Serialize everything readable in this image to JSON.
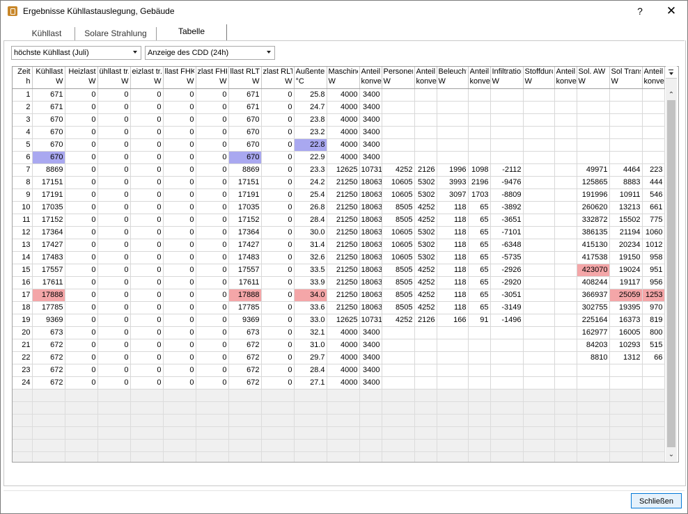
{
  "window": {
    "title": "Ergebnisse Kühllastauslegung, Gebäude",
    "help": "?",
    "close": "✕"
  },
  "tabs": [
    "Kühllast",
    "Solare Strahlung",
    "Tabelle"
  ],
  "active_tab": 2,
  "selects": {
    "month": "höchste Kühllast (Juli)",
    "view": "Anzeige des CDD (24h)"
  },
  "columns": [
    [
      "Zeit",
      "h"
    ],
    [
      "Kühllast",
      "W"
    ],
    [
      "Heizlast",
      "W"
    ],
    [
      "ühllast tr.",
      "W"
    ],
    [
      "eizlast tr.",
      "W"
    ],
    [
      "llast FHK",
      "W"
    ],
    [
      "zlast FHK",
      "W"
    ],
    [
      "llast RLT",
      "W"
    ],
    [
      "zlast RLT",
      "W"
    ],
    [
      "Außenten",
      "°C"
    ],
    [
      "Maschine",
      "W"
    ],
    [
      "Anteil",
      "konve"
    ],
    [
      "Personen",
      "W"
    ],
    [
      "Anteil",
      "konve"
    ],
    [
      "Beleucht",
      "W"
    ],
    [
      "Anteil",
      "konve"
    ],
    [
      "Infiltration",
      "W"
    ],
    [
      "Stoffdurc",
      "W"
    ],
    [
      "Anteil",
      "konve"
    ],
    [
      "Sol. AW",
      "W"
    ],
    [
      "Sol Trans",
      "W"
    ],
    [
      "Anteil",
      "konve"
    ]
  ],
  "rows": [
    [
      "1",
      "671",
      "0",
      "0",
      "0",
      "0",
      "0",
      "671",
      "0",
      "25.8",
      "4000",
      "3400",
      "",
      "",
      "",
      "",
      "",
      "",
      "",
      "",
      "",
      ""
    ],
    [
      "2",
      "671",
      "0",
      "0",
      "0",
      "0",
      "0",
      "671",
      "0",
      "24.7",
      "4000",
      "3400",
      "",
      "",
      "",
      "",
      "",
      "",
      "",
      "",
      "",
      ""
    ],
    [
      "3",
      "670",
      "0",
      "0",
      "0",
      "0",
      "0",
      "670",
      "0",
      "23.8",
      "4000",
      "3400",
      "",
      "",
      "",
      "",
      "",
      "",
      "",
      "",
      "",
      ""
    ],
    [
      "4",
      "670",
      "0",
      "0",
      "0",
      "0",
      "0",
      "670",
      "0",
      "23.2",
      "4000",
      "3400",
      "",
      "",
      "",
      "",
      "",
      "",
      "",
      "",
      "",
      ""
    ],
    [
      "5",
      "670",
      "0",
      "0",
      "0",
      "0",
      "0",
      "670",
      "0",
      "22.8",
      "4000",
      "3400",
      "",
      "",
      "",
      "",
      "",
      "",
      "",
      "",
      "",
      ""
    ],
    [
      "6",
      "670",
      "0",
      "0",
      "0",
      "0",
      "0",
      "670",
      "0",
      "22.9",
      "4000",
      "3400",
      "",
      "",
      "",
      "",
      "",
      "",
      "",
      "",
      "",
      ""
    ],
    [
      "7",
      "8869",
      "0",
      "0",
      "0",
      "0",
      "0",
      "8869",
      "0",
      "23.3",
      "12625",
      "10731",
      "4252",
      "2126",
      "1996",
      "1098",
      "-2112",
      "",
      "",
      "49971",
      "4464",
      "223"
    ],
    [
      "8",
      "17151",
      "0",
      "0",
      "0",
      "0",
      "0",
      "17151",
      "0",
      "24.2",
      "21250",
      "18063",
      "10605",
      "5302",
      "3993",
      "2196",
      "-9476",
      "",
      "",
      "125865",
      "8883",
      "444"
    ],
    [
      "9",
      "17191",
      "0",
      "0",
      "0",
      "0",
      "0",
      "17191",
      "0",
      "25.4",
      "21250",
      "18063",
      "10605",
      "5302",
      "3097",
      "1703",
      "-8809",
      "",
      "",
      "191996",
      "10911",
      "546"
    ],
    [
      "10",
      "17035",
      "0",
      "0",
      "0",
      "0",
      "0",
      "17035",
      "0",
      "26.8",
      "21250",
      "18063",
      "8505",
      "4252",
      "118",
      "65",
      "-3892",
      "",
      "",
      "260620",
      "13213",
      "661"
    ],
    [
      "11",
      "17152",
      "0",
      "0",
      "0",
      "0",
      "0",
      "17152",
      "0",
      "28.4",
      "21250",
      "18063",
      "8505",
      "4252",
      "118",
      "65",
      "-3651",
      "",
      "",
      "332872",
      "15502",
      "775"
    ],
    [
      "12",
      "17364",
      "0",
      "0",
      "0",
      "0",
      "0",
      "17364",
      "0",
      "30.0",
      "21250",
      "18063",
      "10605",
      "5302",
      "118",
      "65",
      "-7101",
      "",
      "",
      "386135",
      "21194",
      "1060"
    ],
    [
      "13",
      "17427",
      "0",
      "0",
      "0",
      "0",
      "0",
      "17427",
      "0",
      "31.4",
      "21250",
      "18063",
      "10605",
      "5302",
      "118",
      "65",
      "-6348",
      "",
      "",
      "415130",
      "20234",
      "1012"
    ],
    [
      "14",
      "17483",
      "0",
      "0",
      "0",
      "0",
      "0",
      "17483",
      "0",
      "32.6",
      "21250",
      "18063",
      "10605",
      "5302",
      "118",
      "65",
      "-5735",
      "",
      "",
      "417538",
      "19150",
      "958"
    ],
    [
      "15",
      "17557",
      "0",
      "0",
      "0",
      "0",
      "0",
      "17557",
      "0",
      "33.5",
      "21250",
      "18063",
      "8505",
      "4252",
      "118",
      "65",
      "-2926",
      "",
      "",
      "423070",
      "19024",
      "951"
    ],
    [
      "16",
      "17611",
      "0",
      "0",
      "0",
      "0",
      "0",
      "17611",
      "0",
      "33.9",
      "21250",
      "18063",
      "8505",
      "4252",
      "118",
      "65",
      "-2920",
      "",
      "",
      "408244",
      "19117",
      "956"
    ],
    [
      "17",
      "17888",
      "0",
      "0",
      "0",
      "0",
      "0",
      "17888",
      "0",
      "34.0",
      "21250",
      "18063",
      "8505",
      "4252",
      "118",
      "65",
      "-3051",
      "",
      "",
      "366937",
      "25059",
      "1253"
    ],
    [
      "18",
      "17785",
      "0",
      "0",
      "0",
      "0",
      "0",
      "17785",
      "0",
      "33.6",
      "21250",
      "18063",
      "8505",
      "4252",
      "118",
      "65",
      "-3149",
      "",
      "",
      "302755",
      "19395",
      "970"
    ],
    [
      "19",
      "9369",
      "0",
      "0",
      "0",
      "0",
      "0",
      "9369",
      "0",
      "33.0",
      "12625",
      "10731",
      "4252",
      "2126",
      "166",
      "91",
      "-1496",
      "",
      "",
      "225164",
      "16373",
      "819"
    ],
    [
      "20",
      "673",
      "0",
      "0",
      "0",
      "0",
      "0",
      "673",
      "0",
      "32.1",
      "4000",
      "3400",
      "",
      "",
      "",
      "",
      "",
      "",
      "",
      "162977",
      "16005",
      "800"
    ],
    [
      "21",
      "672",
      "0",
      "0",
      "0",
      "0",
      "0",
      "672",
      "0",
      "31.0",
      "4000",
      "3400",
      "",
      "",
      "",
      "",
      "",
      "",
      "",
      "84203",
      "10293",
      "515"
    ],
    [
      "22",
      "672",
      "0",
      "0",
      "0",
      "0",
      "0",
      "672",
      "0",
      "29.7",
      "4000",
      "3400",
      "",
      "",
      "",
      "",
      "",
      "",
      "",
      "8810",
      "1312",
      "66"
    ],
    [
      "23",
      "672",
      "0",
      "0",
      "0",
      "0",
      "0",
      "672",
      "0",
      "28.4",
      "4000",
      "3400",
      "",
      "",
      "",
      "",
      "",
      "",
      "",
      "",
      "",
      ""
    ],
    [
      "24",
      "672",
      "0",
      "0",
      "0",
      "0",
      "0",
      "672",
      "0",
      "27.1",
      "4000",
      "3400",
      "",
      "",
      "",
      "",
      "",
      "",
      "",
      "",
      "",
      ""
    ]
  ],
  "highlights": [
    {
      "row": 5,
      "col": 1,
      "color": "blue"
    },
    {
      "row": 5,
      "col": 7,
      "color": "blue"
    },
    {
      "row": 4,
      "col": 9,
      "color": "blue"
    },
    {
      "row": 16,
      "col": 1,
      "color": "red"
    },
    {
      "row": 16,
      "col": 7,
      "color": "red"
    },
    {
      "row": 16,
      "col": 9,
      "color": "red"
    },
    {
      "row": 14,
      "col": 19,
      "color": "red"
    },
    {
      "row": 16,
      "col": 20,
      "color": "red"
    },
    {
      "row": 16,
      "col": 21,
      "color": "red"
    }
  ],
  "empty_rows": 6,
  "footer": {
    "close_button": "Schließen"
  },
  "colors": {
    "highlight_min": "#a9a8f0",
    "highlight_max": "#f4a6a8",
    "accent": "#0078d7"
  }
}
